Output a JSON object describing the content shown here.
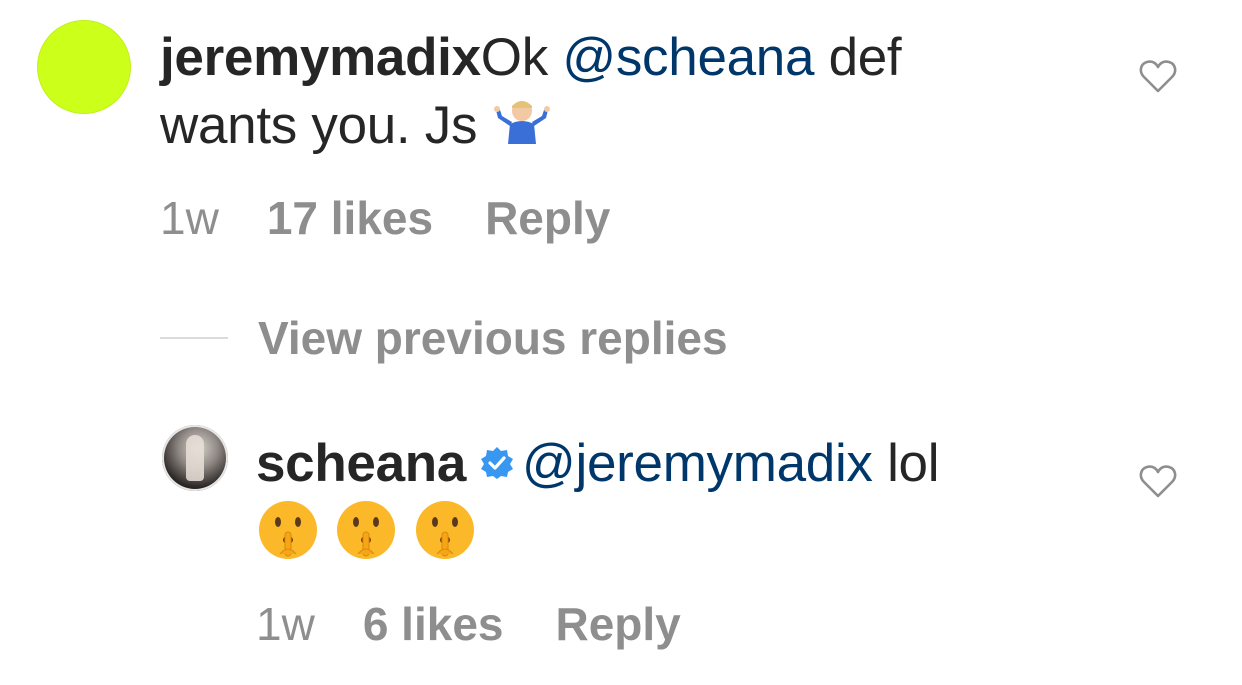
{
  "comment": {
    "username": "jeremymadix",
    "text_before_mention": "Ok ",
    "mention": "@scheana",
    "text_after_mention": " def",
    "text_line2": "wants you. Js ",
    "emoji": "🤷🏼‍♂️",
    "time": "1w",
    "likes": "17 likes",
    "reply_label": "Reply",
    "avatar_color": "#ccff1a"
  },
  "view_previous": {
    "label": "View previous replies"
  },
  "reply": {
    "username": "scheana",
    "verified": true,
    "mention": "@jeremymadix",
    "text_after_mention": " lol",
    "emojis": "🤫 🤫 🤫",
    "time": "1w",
    "likes": "6 likes",
    "reply_label": "Reply"
  },
  "icons": {
    "like": "heart-outline-icon",
    "verified": "verified-badge-icon"
  },
  "colors": {
    "text": "#262626",
    "mention": "#00376b",
    "meta": "#8e8e8e",
    "verified": "#3897f0",
    "divider": "#dbdbdb"
  }
}
